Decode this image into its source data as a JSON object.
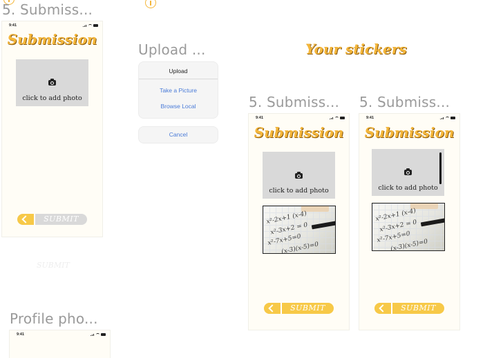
{
  "frames": {
    "submission_1": "5. Submiss...",
    "submission_2": "5. Submiss...",
    "submission_3": "5. Submiss...",
    "upload": "Upload ...",
    "profile": "Profile pho..."
  },
  "status_bar": {
    "time": "9:41"
  },
  "screen": {
    "title": "Submission",
    "photo_label": "click to add photo",
    "submit_label": "SUBMIT"
  },
  "upload_sheet": {
    "title": "Upload",
    "take_picture": "Take a Picture",
    "browse_local": "Browse Local",
    "cancel": "Cancel"
  },
  "stickers_title": "Your stickers",
  "ghost_submit": "SUBMIT",
  "photo_formulas": [
    "x²-2x+1 (x-4)",
    "x²-3x+2 = 0",
    "x²-7x+5=0",
    "(x-3)(x-5)=0"
  ],
  "colors": {
    "accent": "#f7c948",
    "title": "#f4b63a",
    "link": "#4a7bd8",
    "photo_bg": "#d9d9d9"
  },
  "icons": [
    "camera-icon",
    "back-chevron-icon",
    "info-icon",
    "signal-icon",
    "wifi-icon",
    "battery-icon"
  ]
}
